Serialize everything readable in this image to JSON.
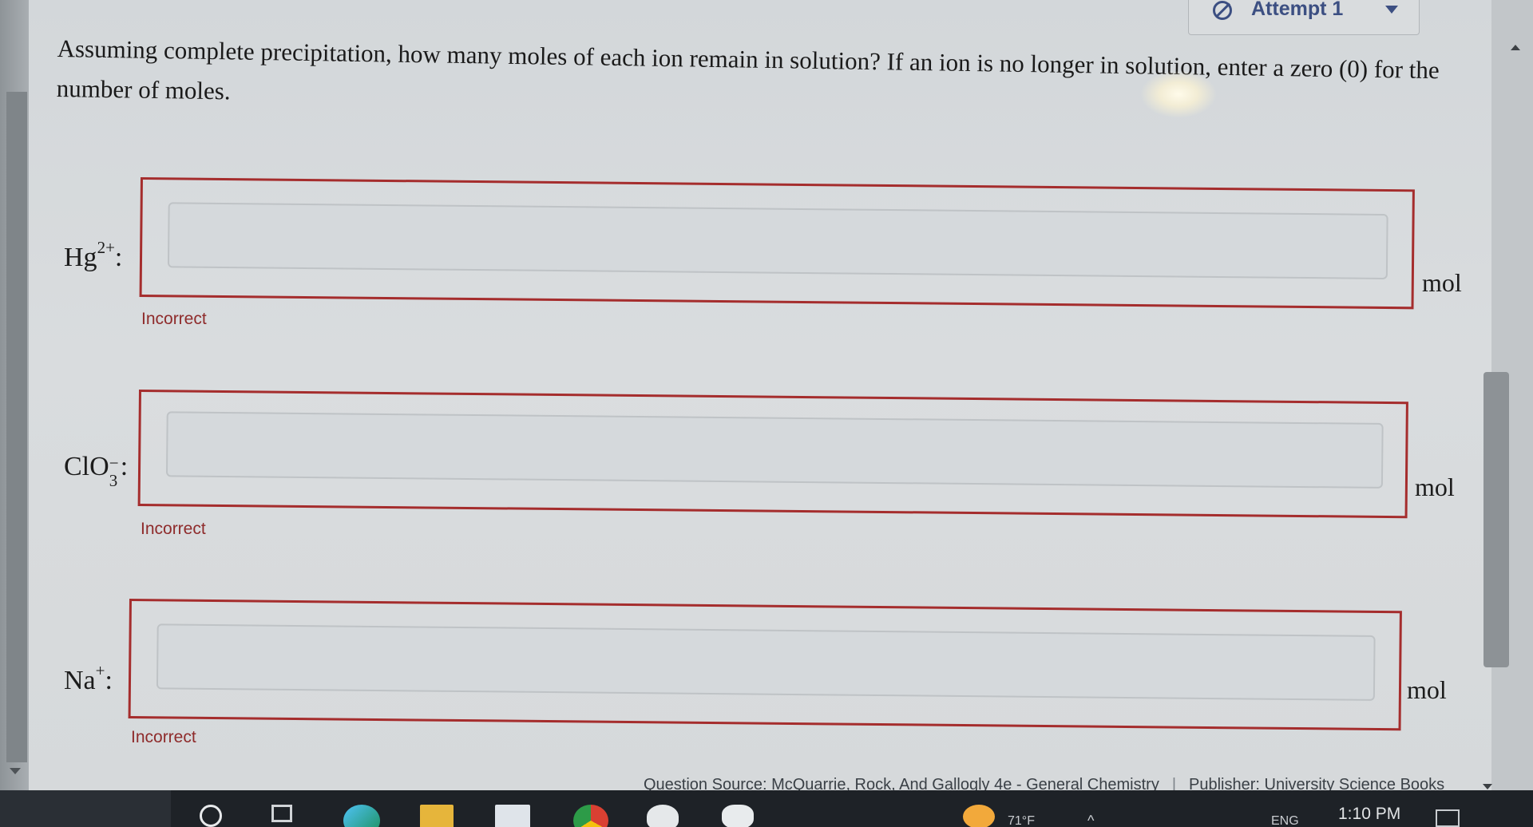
{
  "attempt": {
    "label": "Attempt 1",
    "icon": "ban-icon"
  },
  "question": {
    "text": "Assuming complete precipitation, how many moles of each ion remain in solution? If an ion is no longer in solution, enter a zero (0) for the number of moles."
  },
  "ions": [
    {
      "symbol": "Hg",
      "charge": "2+",
      "value": "",
      "unit": "mol",
      "feedback": "Incorrect"
    },
    {
      "symbol": "ClO",
      "subscript": "3",
      "charge": "−",
      "value": "",
      "unit": "mol",
      "feedback": "Incorrect"
    },
    {
      "symbol": "Na",
      "charge": "+",
      "value": "",
      "unit": "mol",
      "feedback": "Incorrect"
    }
  ],
  "footer": {
    "source": "Question Source: McQuarrie, Rock, And Gallogly 4e - General Chemistry",
    "publisher": "Publisher: University Science Books"
  },
  "taskbar": {
    "temperature": "71°F",
    "language": "ENG",
    "time": "1:10 PM"
  },
  "colors": {
    "error_border": "#a52d2d",
    "error_text": "#8e2b2b",
    "attempt_accent": "#3c4f82"
  }
}
